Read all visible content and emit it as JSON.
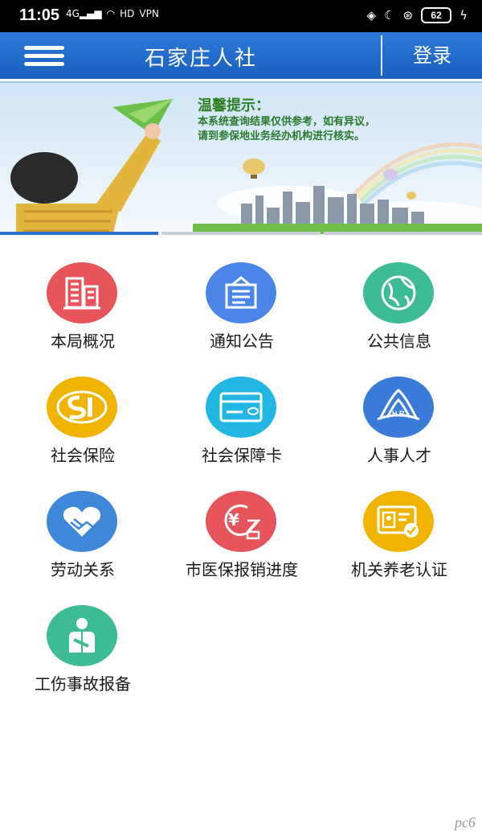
{
  "status_bar": {
    "time": "11:05",
    "network": "4G",
    "hd": "HD",
    "vpn": "VPN",
    "battery": "62"
  },
  "header": {
    "title": "石家庄人社",
    "login_label": "登录"
  },
  "banner": {
    "notice_title": "温馨提示：",
    "notice_line1": "本系统查询结果仅供参考，如有异议，",
    "notice_line2": "请到参保地业务经办机构进行核实。"
  },
  "grid": [
    {
      "label": "本局概况",
      "icon": "building-icon",
      "color": "#e7545a"
    },
    {
      "label": "通知公告",
      "icon": "notice-board-icon",
      "color": "#4a86e8"
    },
    {
      "label": "公共信息",
      "icon": "globe-icon",
      "color": "#3dbb94"
    },
    {
      "label": "社会保险",
      "icon": "social-insurance-logo-icon",
      "color": "#f0b400"
    },
    {
      "label": "社会保障卡",
      "icon": "card-icon",
      "color": "#22b6e3"
    },
    {
      "label": "人事人才",
      "icon": "hr-icon",
      "color": "#3a7ad8"
    },
    {
      "label": "劳动关系",
      "icon": "handshake-heart-icon",
      "color": "#3f87d8"
    },
    {
      "label": "市医保报销进度",
      "icon": "yuan-hourglass-icon",
      "color": "#e7545a"
    },
    {
      "label": "机关养老认证",
      "icon": "id-card-check-icon",
      "color": "#f0b400"
    },
    {
      "label": "工伤事故报备",
      "icon": "injured-person-icon",
      "color": "#3dbb94"
    }
  ],
  "watermark": "pc6"
}
